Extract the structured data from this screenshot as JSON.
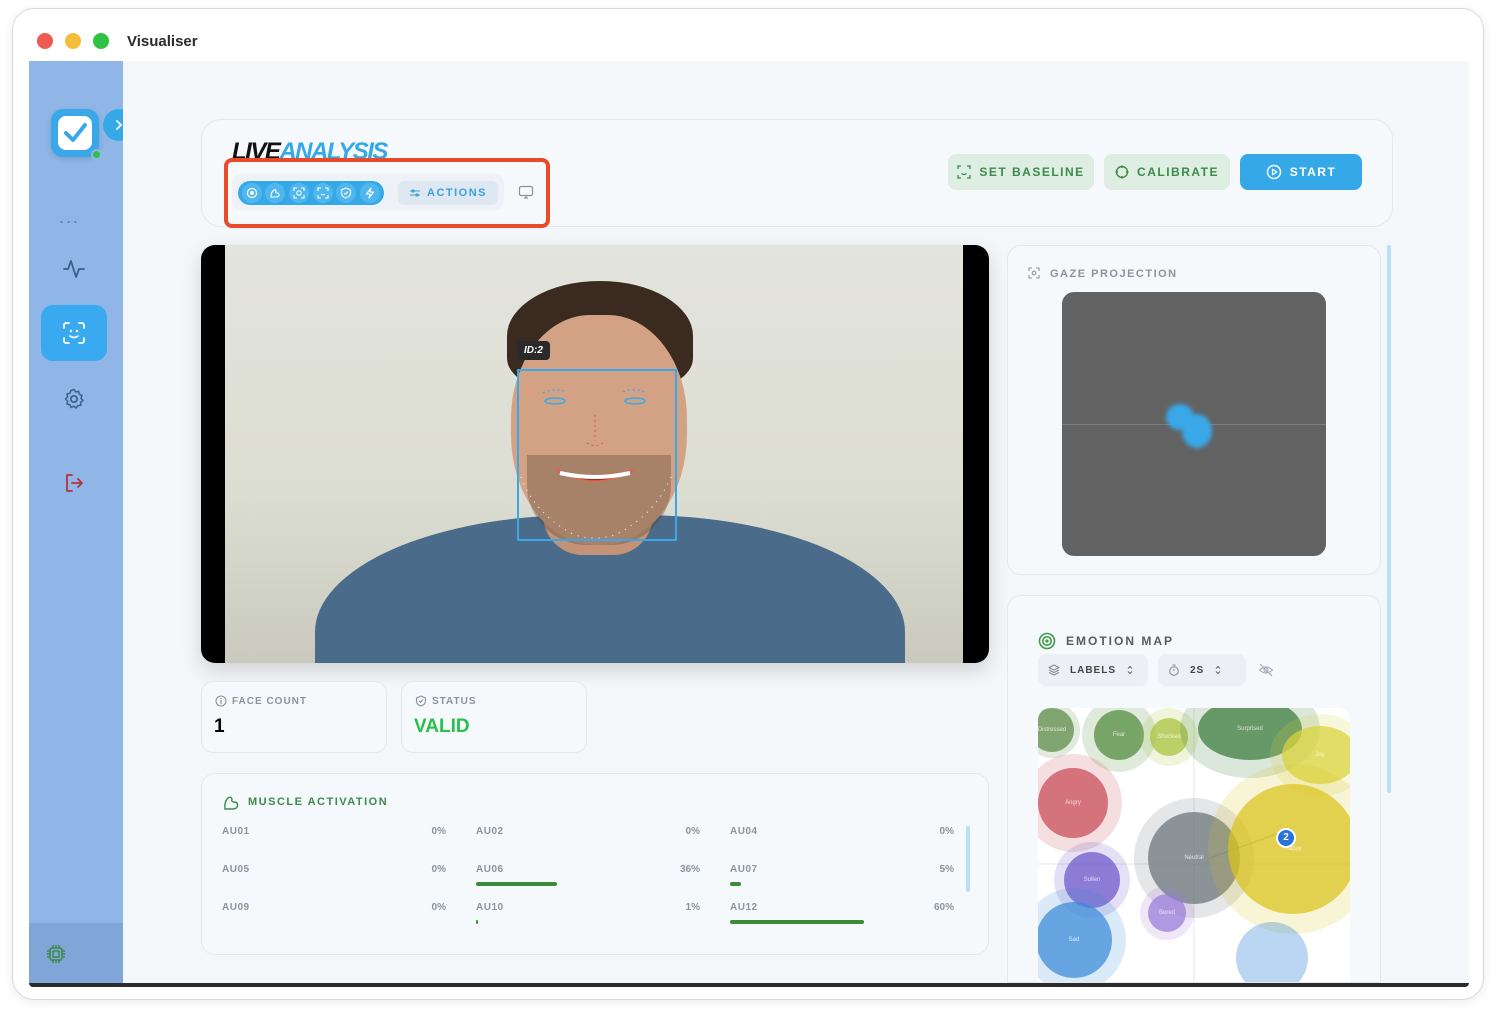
{
  "window": {
    "title": "Visualiser"
  },
  "sidebar": {
    "items": [
      {
        "icon": "activity-icon",
        "active": false
      },
      {
        "icon": "face-scan-icon",
        "active": true
      },
      {
        "icon": "gear-icon",
        "active": false
      },
      {
        "icon": "logout-icon",
        "active": false
      }
    ],
    "more": "...",
    "footer_icon": "cpu-chip-icon"
  },
  "header": {
    "title_part1": "LIVE",
    "title_part2": "ANALYSIS",
    "actions_label": "ACTIONS",
    "set_baseline_label": "SET BASELINE",
    "calibrate_label": "CALIBRATE",
    "start_label": "START"
  },
  "video": {
    "face_id": "ID:2"
  },
  "stats": {
    "face_count_label": "FACE COUNT",
    "face_count_value": "1",
    "status_label": "STATUS",
    "status_value": "VALID"
  },
  "muscle": {
    "title": "MUSCLE ACTIVATION",
    "units": [
      {
        "name": "AU01",
        "value": "0%",
        "level": 0
      },
      {
        "name": "AU02",
        "value": "0%",
        "level": 0
      },
      {
        "name": "AU04",
        "value": "0%",
        "level": 0
      },
      {
        "name": "AU05",
        "value": "0%",
        "level": 0
      },
      {
        "name": "AU06",
        "value": "36%",
        "level": 0.36
      },
      {
        "name": "AU07",
        "value": "5%",
        "level": 0.05
      },
      {
        "name": "AU09",
        "value": "0%",
        "level": 0
      },
      {
        "name": "AU10",
        "value": "1%",
        "level": 0.01
      },
      {
        "name": "AU12",
        "value": "60%",
        "level": 0.6
      }
    ]
  },
  "gaze": {
    "title": "GAZE PROJECTION"
  },
  "emotion": {
    "title": "EMOTION MAP",
    "labels_ctrl": "LABELS",
    "time_ctrl": "2S",
    "marker_label": "2",
    "bubbles": [
      {
        "label": "Distressed",
        "color": "#5c8a46"
      },
      {
        "label": "Fear",
        "color": "#4f8a3a"
      },
      {
        "label": "Shocked",
        "color": "#a7c23a"
      },
      {
        "label": "Surprised",
        "color": "#3a7a3a"
      },
      {
        "label": "Joy",
        "color": "#d9d23a"
      },
      {
        "label": "Angry",
        "color": "#c94a55"
      },
      {
        "label": "Neutral",
        "color": "#6a7378"
      },
      {
        "label": "Happy",
        "color": "#d9c31a"
      },
      {
        "label": "Sullen",
        "color": "#6a55c9"
      },
      {
        "label": "Bored",
        "color": "#9a7ad9"
      },
      {
        "label": "Sad",
        "color": "#3a8ad9"
      }
    ]
  }
}
